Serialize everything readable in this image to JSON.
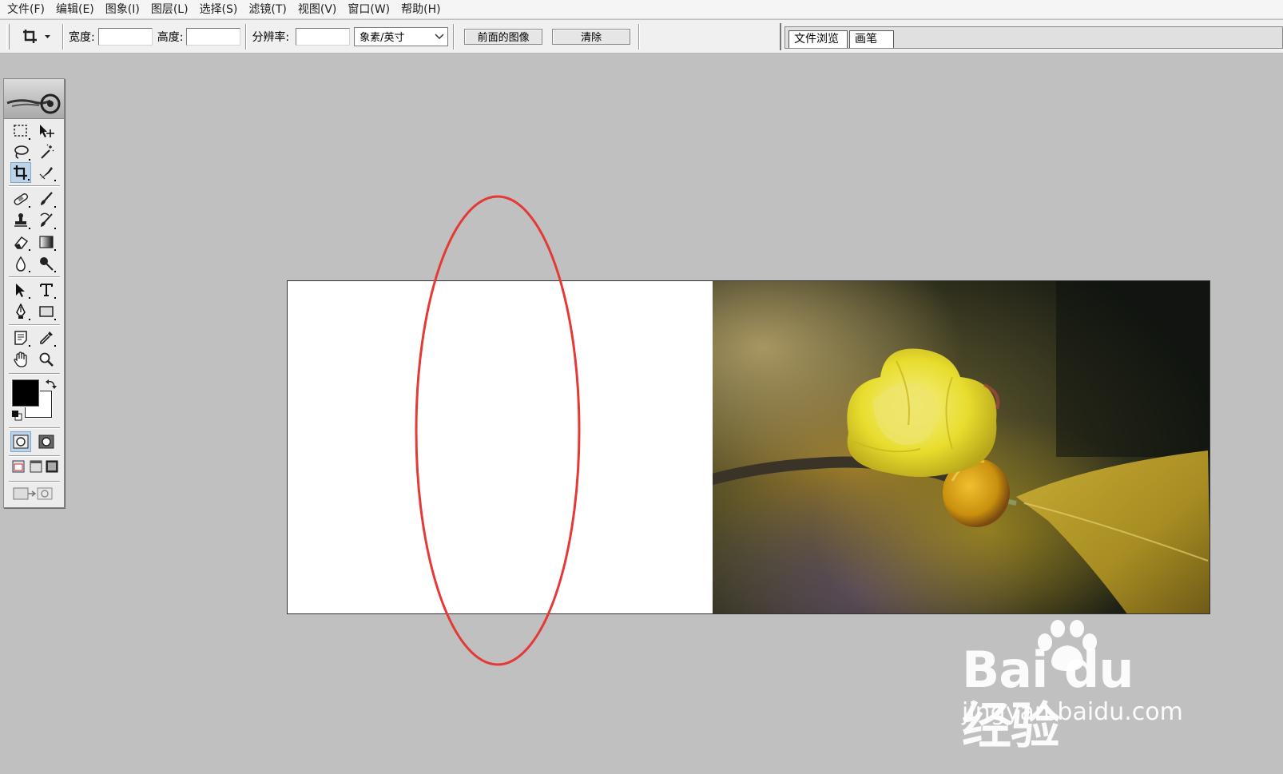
{
  "menubar": {
    "items": [
      "文件(F)",
      "编辑(E)",
      "图象(I)",
      "图层(L)",
      "选择(S)",
      "滤镜(T)",
      "视图(V)",
      "窗口(W)",
      "帮助(H)"
    ]
  },
  "options": {
    "width_label": "宽度:",
    "width_value": "",
    "height_label": "高度:",
    "height_value": "",
    "resolution_label": "分辨率:",
    "resolution_value": "",
    "unit_selected": "象素/英寸",
    "front_image_button": "前面的图像",
    "clear_button": "清除"
  },
  "palette_well": {
    "tabs": [
      "文件浏览",
      "画笔"
    ]
  },
  "toolbox": {
    "tools": [
      "rectangular-marquee",
      "move",
      "lasso",
      "magic-wand",
      "crop",
      "slice",
      "healing-brush",
      "brush",
      "clone-stamp",
      "history-brush",
      "eraser",
      "gradient",
      "blur",
      "dodge",
      "path-selection",
      "type",
      "pen",
      "rectangle",
      "notes",
      "eyedropper",
      "hand",
      "zoom"
    ],
    "active_tool": "crop",
    "foreground_color": "#000000",
    "background_color": "#ffffff"
  },
  "canvas": {
    "annotation_color": "#e53935"
  },
  "watermark": {
    "brand": "Bai du 经验",
    "url": "jingyan.baidu.com"
  }
}
